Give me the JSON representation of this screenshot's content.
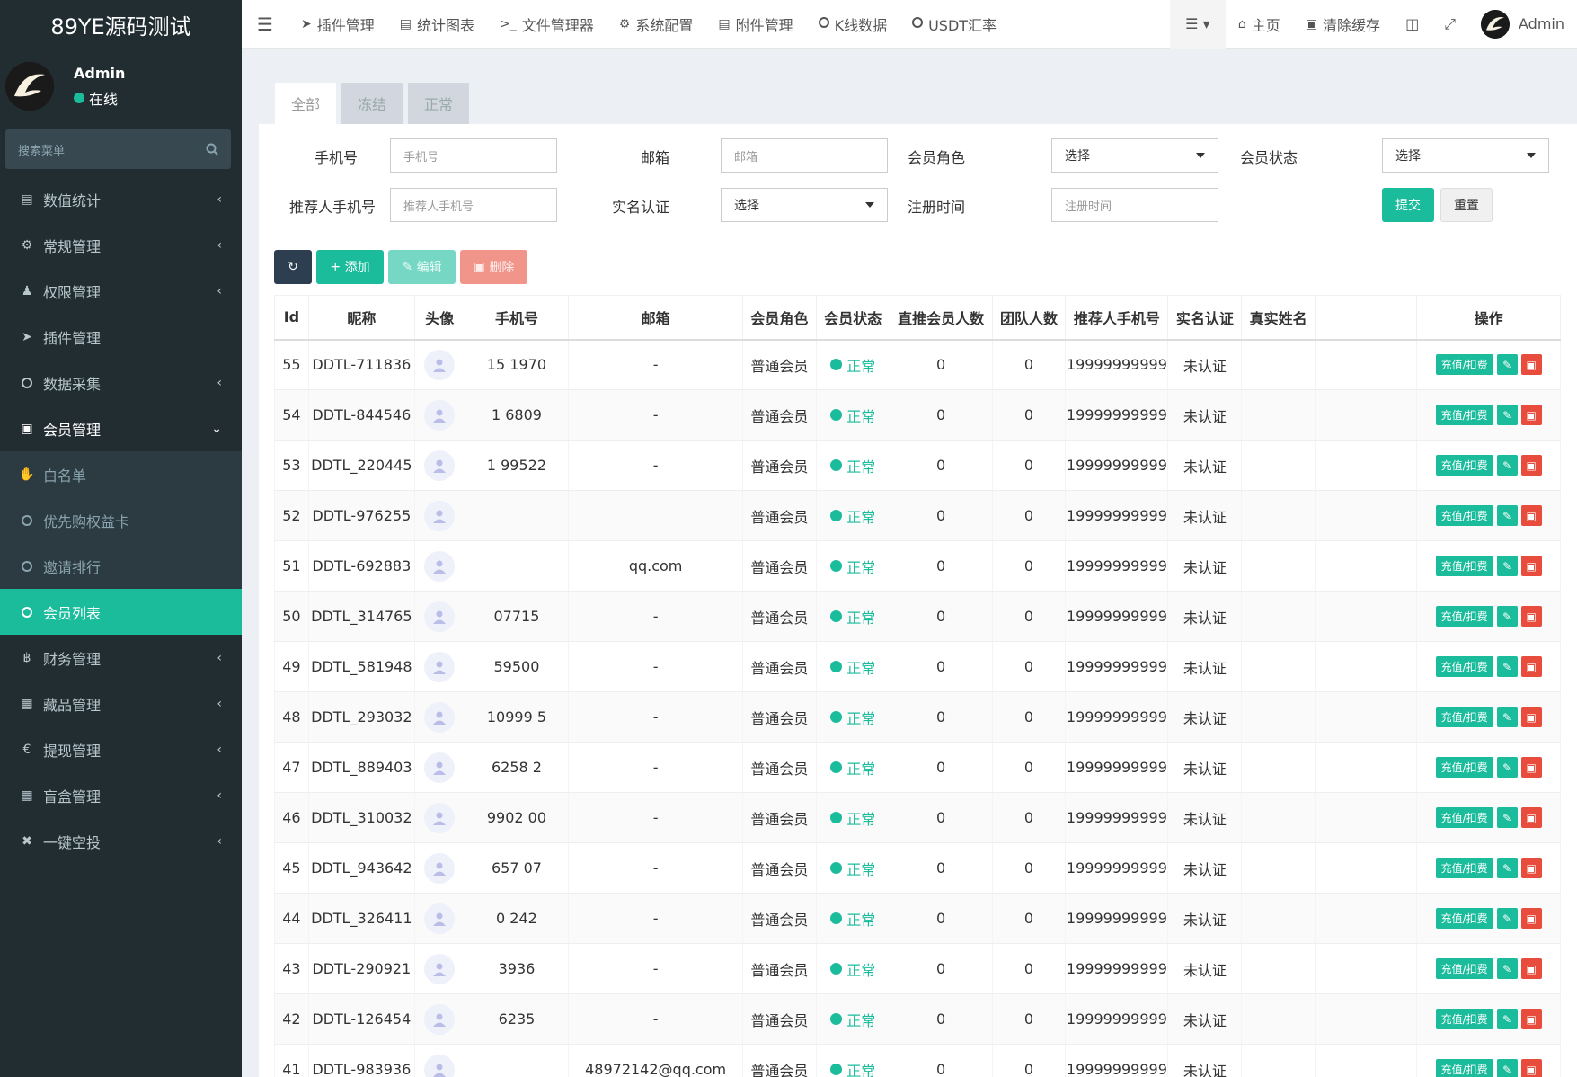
{
  "app": {
    "title": "89YE源码测试"
  },
  "user": {
    "name": "Admin",
    "status": "在线"
  },
  "search": {
    "placeholder": "搜索菜单"
  },
  "sidebar": {
    "items": [
      {
        "label": "数值统计",
        "icon": "bar-chart-icon"
      },
      {
        "label": "常规管理",
        "icon": "cogs-icon"
      },
      {
        "label": "权限管理",
        "icon": "users-icon"
      },
      {
        "label": "插件管理",
        "icon": "rocket-icon"
      },
      {
        "label": "数据采集",
        "icon": "circle-icon"
      },
      {
        "label": "会员管理",
        "icon": "id-card-icon"
      }
    ],
    "sub": [
      {
        "label": "白名单",
        "icon": "handshake-icon"
      },
      {
        "label": "优先购权益卡",
        "icon": "circle-icon"
      },
      {
        "label": "邀请排行",
        "icon": "circle-icon"
      },
      {
        "label": "会员列表",
        "icon": "circle-icon"
      }
    ],
    "items2": [
      {
        "label": "财务管理",
        "icon": "bitcoin-icon"
      },
      {
        "label": "藏品管理",
        "icon": "calendar-icon"
      },
      {
        "label": "提现管理",
        "icon": "euro-icon"
      },
      {
        "label": "盲盒管理",
        "icon": "grid-icon"
      },
      {
        "label": "一键空投",
        "icon": "plane-icon"
      }
    ]
  },
  "topnav": {
    "items": [
      "插件管理",
      "统计图表",
      "文件管理器",
      "系统配置",
      "附件管理",
      "K线数据",
      "USDT汇率"
    ],
    "home": "主页",
    "clear": "清除缓存",
    "admin": "Admin"
  },
  "tabs": [
    "全部",
    "冻结",
    "正常"
  ],
  "filters": {
    "phone_label": "手机号",
    "phone_ph": "手机号",
    "email_label": "邮箱",
    "email_ph": "邮箱",
    "role_label": "会员角色",
    "role_value": "选择",
    "state_label": "会员状态",
    "state_value": "选择",
    "ref_label": "推荐人手机号",
    "ref_ph": "推荐人手机号",
    "auth_label": "实名认证",
    "auth_value": "选择",
    "reg_label": "注册时间",
    "reg_ph": "注册时间",
    "submit": "提交",
    "reset": "重置"
  },
  "toolbar": {
    "add": "添加",
    "edit": "编辑",
    "delete": "删除"
  },
  "table": {
    "headers": [
      "Id",
      "昵称",
      "头像",
      "手机号",
      "邮箱",
      "会员角色",
      "会员状态",
      "直推会员人数",
      "团队人数",
      "推荐人手机号",
      "实名认证",
      "真实姓名",
      "",
      "操作"
    ],
    "charge_label": "充值/扣费",
    "rows": [
      {
        "id": "55",
        "nick": "DDTL-711836",
        "phone": "15 1970",
        "email": "-",
        "role": "普通会员",
        "status": "正常",
        "direct": "0",
        "team": "0",
        "ref": "19999999999",
        "auth": "未认证"
      },
      {
        "id": "54",
        "nick": "DDTL-844546",
        "phone": "1 6809",
        "email": "-",
        "role": "普通会员",
        "status": "正常",
        "direct": "0",
        "team": "0",
        "ref": "19999999999",
        "auth": "未认证"
      },
      {
        "id": "53",
        "nick": "DDTL_220445",
        "phone": "1 99522",
        "email": "-",
        "role": "普通会员",
        "status": "正常",
        "direct": "0",
        "team": "0",
        "ref": "19999999999",
        "auth": "未认证"
      },
      {
        "id": "52",
        "nick": "DDTL-976255",
        "phone": "",
        "email": "",
        "role": "普通会员",
        "status": "正常",
        "direct": "0",
        "team": "0",
        "ref": "19999999999",
        "auth": "未认证"
      },
      {
        "id": "51",
        "nick": "DDTL-692883",
        "phone": "",
        "email": "qq.com",
        "role": "普通会员",
        "status": "正常",
        "direct": "0",
        "team": "0",
        "ref": "19999999999",
        "auth": "未认证"
      },
      {
        "id": "50",
        "nick": "DDTL_314765",
        "phone": "07715",
        "email": "-",
        "role": "普通会员",
        "status": "正常",
        "direct": "0",
        "team": "0",
        "ref": "19999999999",
        "auth": "未认证"
      },
      {
        "id": "49",
        "nick": "DDTL_581948",
        "phone": "59500",
        "email": "-",
        "role": "普通会员",
        "status": "正常",
        "direct": "0",
        "team": "0",
        "ref": "19999999999",
        "auth": "未认证"
      },
      {
        "id": "48",
        "nick": "DDTL_293032",
        "phone": "10999 5",
        "email": "-",
        "role": "普通会员",
        "status": "正常",
        "direct": "0",
        "team": "0",
        "ref": "19999999999",
        "auth": "未认证"
      },
      {
        "id": "47",
        "nick": "DDTL_889403",
        "phone": "6258 2",
        "email": "-",
        "role": "普通会员",
        "status": "正常",
        "direct": "0",
        "team": "0",
        "ref": "19999999999",
        "auth": "未认证"
      },
      {
        "id": "46",
        "nick": "DDTL_310032",
        "phone": "9902 00",
        "email": "-",
        "role": "普通会员",
        "status": "正常",
        "direct": "0",
        "team": "0",
        "ref": "19999999999",
        "auth": "未认证"
      },
      {
        "id": "45",
        "nick": "DDTL_943642",
        "phone": "657 07",
        "email": "-",
        "role": "普通会员",
        "status": "正常",
        "direct": "0",
        "team": "0",
        "ref": "19999999999",
        "auth": "未认证"
      },
      {
        "id": "44",
        "nick": "DDTL_326411",
        "phone": "0 242",
        "email": "-",
        "role": "普通会员",
        "status": "正常",
        "direct": "0",
        "team": "0",
        "ref": "19999999999",
        "auth": "未认证"
      },
      {
        "id": "43",
        "nick": "DDTL-290921",
        "phone": "3936",
        "email": "-",
        "role": "普通会员",
        "status": "正常",
        "direct": "0",
        "team": "0",
        "ref": "19999999999",
        "auth": "未认证"
      },
      {
        "id": "42",
        "nick": "DDTL-126454",
        "phone": "6235",
        "email": "-",
        "role": "普通会员",
        "status": "正常",
        "direct": "0",
        "team": "0",
        "ref": "19999999999",
        "auth": "未认证"
      },
      {
        "id": "41",
        "nick": "DDTL-983936",
        "phone": "",
        "email": "48972142@qq.com",
        "role": "普通会员",
        "status": "正常",
        "direct": "0",
        "team": "0",
        "ref": "19999999999",
        "auth": "未认证"
      }
    ]
  },
  "colors": {
    "accent": "#1abc9c",
    "sidebar": "#222d32",
    "danger": "#e74c3c"
  }
}
